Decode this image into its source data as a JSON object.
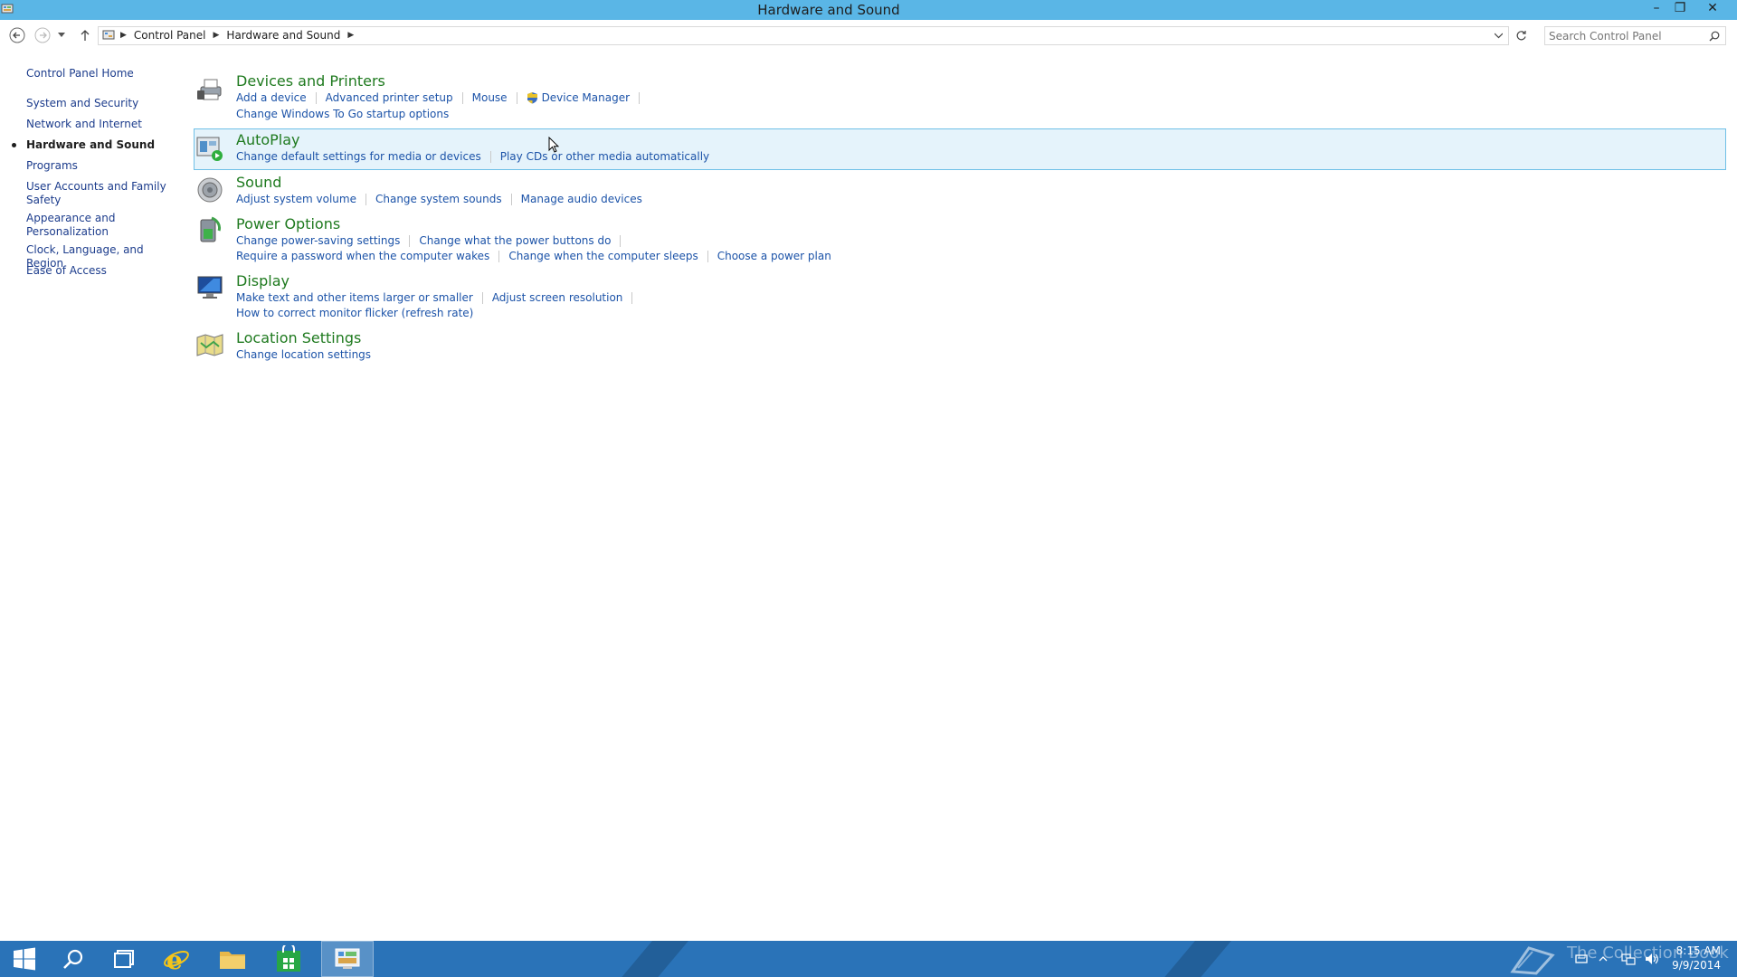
{
  "window": {
    "title": "Hardware and Sound",
    "minimize_glyph": "–",
    "restore_glyph": "❐",
    "close_glyph": "✕"
  },
  "address": {
    "crumbs": [
      "Control Panel",
      "Hardware and Sound"
    ],
    "search_placeholder": "Search Control Panel"
  },
  "leftnav": {
    "home": "Control Panel Home",
    "items": [
      {
        "label": "System and Security"
      },
      {
        "label": "Network and Internet"
      },
      {
        "label": "Hardware and Sound",
        "active": true
      },
      {
        "label": "Programs"
      },
      {
        "label": "User Accounts and Family Safety"
      },
      {
        "label": "Appearance and Personalization"
      },
      {
        "label": "Clock, Language, and Region"
      },
      {
        "label": "Ease of Access"
      }
    ]
  },
  "categories": [
    {
      "title": "Devices and Printers",
      "icon": "printer-icon",
      "links_row1": [
        "Add a device",
        "Advanced printer setup",
        "Mouse",
        "Device Manager"
      ],
      "links_row2": [
        "Change Windows To Go startup options"
      ]
    },
    {
      "title": "AutoPlay",
      "icon": "autoplay-icon",
      "links_row1": [
        "Change default settings for media or devices",
        "Play CDs or other media automatically"
      ]
    },
    {
      "title": "Sound",
      "icon": "speaker-icon",
      "links_row1": [
        "Adjust system volume",
        "Change system sounds",
        "Manage audio devices"
      ]
    },
    {
      "title": "Power Options",
      "icon": "battery-icon",
      "links_row1": [
        "Change power-saving settings",
        "Change what the power buttons do"
      ],
      "links_row2": [
        "Require a password when the computer wakes",
        "Change when the computer sleeps",
        "Choose a power plan"
      ]
    },
    {
      "title": "Display",
      "icon": "monitor-icon",
      "links_row1": [
        "Make text and other items larger or smaller",
        "Adjust screen resolution"
      ],
      "links_row2": [
        "How to correct monitor flicker (refresh rate)"
      ]
    },
    {
      "title": "Location Settings",
      "icon": "location-map-icon",
      "links_row1": [
        "Change location settings"
      ]
    }
  ],
  "taskbar": {
    "time": "8:15 AM",
    "date": "9/9/2014",
    "watermark": "The Collection Book",
    "apps": [
      "start-icon",
      "search-icon",
      "task-view-icon",
      "internet-explorer-icon",
      "file-explorer-icon",
      "store-icon",
      "control-panel-icon"
    ]
  },
  "colors": {
    "titlebar": "#5ab6e6",
    "category_title": "#1f7a1f",
    "link": "#1c53a8",
    "taskbar": "#2a73b8"
  }
}
